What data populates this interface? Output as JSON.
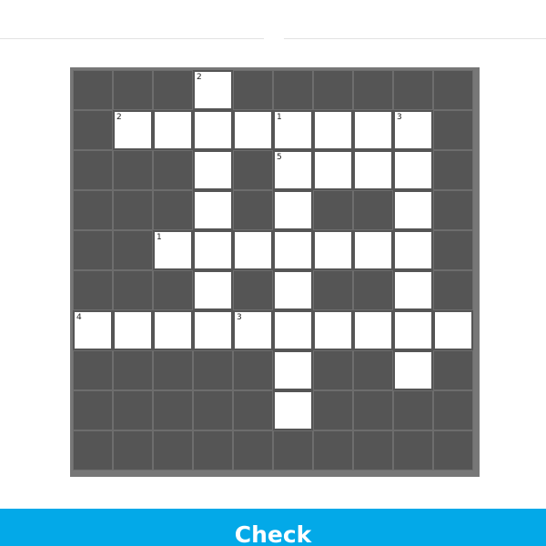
{
  "puzzle": {
    "rows": 10,
    "cols": 10,
    "open_cells": [
      [
        0,
        3
      ],
      [
        1,
        1
      ],
      [
        1,
        2
      ],
      [
        1,
        3
      ],
      [
        1,
        4
      ],
      [
        1,
        5
      ],
      [
        1,
        6
      ],
      [
        1,
        7
      ],
      [
        1,
        8
      ],
      [
        2,
        3
      ],
      [
        2,
        5
      ],
      [
        2,
        6
      ],
      [
        2,
        7
      ],
      [
        2,
        8
      ],
      [
        3,
        3
      ],
      [
        3,
        5
      ],
      [
        3,
        8
      ],
      [
        4,
        2
      ],
      [
        4,
        3
      ],
      [
        4,
        4
      ],
      [
        4,
        5
      ],
      [
        4,
        6
      ],
      [
        4,
        7
      ],
      [
        4,
        8
      ],
      [
        5,
        3
      ],
      [
        5,
        5
      ],
      [
        5,
        8
      ],
      [
        6,
        0
      ],
      [
        6,
        1
      ],
      [
        6,
        2
      ],
      [
        6,
        3
      ],
      [
        6,
        4
      ],
      [
        6,
        5
      ],
      [
        6,
        6
      ],
      [
        6,
        7
      ],
      [
        6,
        8
      ],
      [
        6,
        9
      ],
      [
        7,
        5
      ],
      [
        7,
        8
      ],
      [
        8,
        5
      ]
    ],
    "clue_numbers": [
      {
        "row": 0,
        "col": 3,
        "label": "2"
      },
      {
        "row": 1,
        "col": 1,
        "label": "2"
      },
      {
        "row": 1,
        "col": 5,
        "label": "1"
      },
      {
        "row": 1,
        "col": 8,
        "label": "3"
      },
      {
        "row": 2,
        "col": 5,
        "label": "5"
      },
      {
        "row": 4,
        "col": 2,
        "label": "1"
      },
      {
        "row": 6,
        "col": 0,
        "label": "4"
      },
      {
        "row": 6,
        "col": 4,
        "label": "3"
      }
    ]
  },
  "check_button": {
    "label": "Check",
    "color": "#03a9e8"
  },
  "colors": {
    "block": "#555555",
    "open": "#ffffff",
    "board_border": "#777777"
  }
}
